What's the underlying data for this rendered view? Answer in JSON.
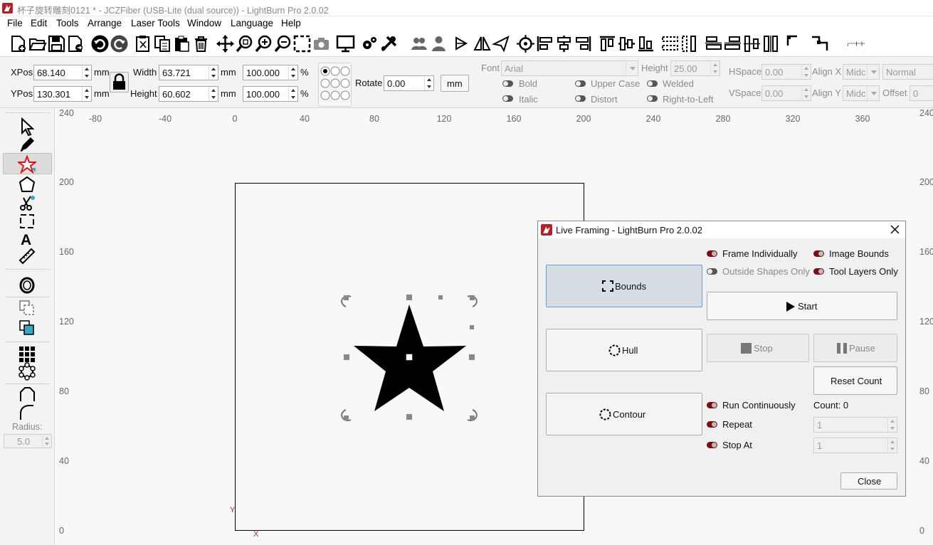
{
  "window": {
    "title": "杯子旋转雕刻0121 * - JCZFiber (USB-Lite (dual source)) - LightBurn Pro 2.0.02"
  },
  "menu": [
    "File",
    "Edit",
    "Tools",
    "Arrange",
    "Laser Tools",
    "Window",
    "Language",
    "Help"
  ],
  "props": {
    "xpos_label": "XPos",
    "xpos": "68.140",
    "ypos_label": "YPos",
    "ypos": "130.301",
    "unit": "mm",
    "width_label": "Width",
    "width": "63.721",
    "height_label": "Height",
    "height": "60.602",
    "scale_x": "100.000",
    "scale_y": "100.000",
    "percent": "%",
    "rotate_label": "Rotate",
    "rotate": "0.00",
    "unit_btn": "mm"
  },
  "text_props": {
    "font_label": "Font",
    "font": "Arial",
    "height_label": "Height",
    "height": "25.00",
    "bold": "Bold",
    "italic": "Italic",
    "upper_case": "Upper Case",
    "distort": "Distort",
    "welded": "Welded",
    "rtl": "Right-to-Left",
    "hspace_label": "HSpace",
    "hspace": "0.00",
    "vspace_label": "VSpace",
    "vspace": "0.00",
    "alignx_label": "Align X",
    "alignx": "Midc",
    "aligny_label": "Align Y",
    "aligny": "Midc",
    "style": "Normal",
    "offset_label": "Offset",
    "offset": "0"
  },
  "left_tools": {
    "radius_label": "Radius:",
    "radius": "5.0"
  },
  "ruler": {
    "x_ticks": [
      "-80",
      "-40",
      "0",
      "40",
      "80",
      "120",
      "160",
      "200",
      "240",
      "280",
      "320",
      "360"
    ],
    "y_ticks": [
      "240",
      "200",
      "160",
      "120",
      "80",
      "40",
      "0"
    ],
    "right_ticks": [
      "240",
      "200",
      "160",
      "120",
      "80",
      "40",
      "0"
    ],
    "x_axis": "X",
    "y_axis": "Y"
  },
  "dialog": {
    "title": "Live Framing - LightBurn Pro 2.0.02",
    "bounds": "Bounds",
    "hull": "Hull",
    "contour": "Contour",
    "frame_individually": "Frame Individually",
    "image_bounds": "Image Bounds",
    "outside_shapes_only": "Outside Shapes Only",
    "tool_layers_only": "Tool Layers Only",
    "start": "Start",
    "stop": "Stop",
    "pause": "Pause",
    "reset_count": "Reset Count",
    "run_continuously": "Run Continuously",
    "repeat": "Repeat",
    "stop_at": "Stop At",
    "count": "Count: 0",
    "repeat_value": "1",
    "stop_at_value": "1",
    "close": "Close"
  },
  "colors": {
    "accent": "#7a0e0e",
    "selection": "#d7dde5",
    "star": "#000000"
  }
}
